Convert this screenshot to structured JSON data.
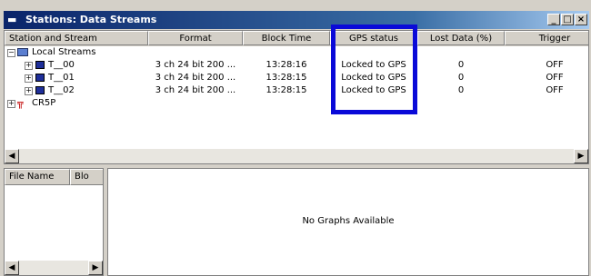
{
  "window": {
    "title": "Stations: Data Streams",
    "buttons": [
      "minimize-icon",
      "maximize-icon",
      "close-icon"
    ]
  },
  "columns": [
    "Station and Stream",
    "Format",
    "Block Time",
    "GPS status",
    "Lost Data (%)",
    "Trigger"
  ],
  "tree": {
    "root_label": "Local Streams",
    "streams": [
      {
        "name": "T__00",
        "format": "3 ch 24 bit 200 ...",
        "block_time": "13:28:16",
        "gps": "Locked to GPS",
        "lost": "0",
        "trigger": "OFF"
      },
      {
        "name": "T__01",
        "format": "3 ch 24 bit 200 ...",
        "block_time": "13:28:15",
        "gps": "Locked to GPS",
        "lost": "0",
        "trigger": "OFF"
      },
      {
        "name": "T__02",
        "format": "3 ch 24 bit 200 ...",
        "block_time": "13:28:15",
        "gps": "Locked to GPS",
        "lost": "0",
        "trigger": "OFF"
      }
    ],
    "other_label": "CR5P"
  },
  "file_pane": {
    "columns": [
      "File Name",
      "Blo"
    ]
  },
  "graph_pane": {
    "message": "No Graphs Available"
  },
  "colors": {
    "highlight_box": "#0a0ad8",
    "titlebar": "#0a246a"
  }
}
